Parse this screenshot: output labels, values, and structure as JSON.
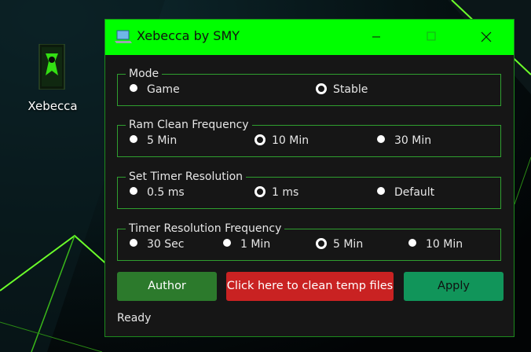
{
  "desktop": {
    "icon_label": "Xebecca",
    "accent_color": "#7cff3a"
  },
  "window": {
    "title": "Xebecca by SMY",
    "titlebar_color": "#00ff00"
  },
  "groups": [
    {
      "title": "Mode",
      "options": [
        {
          "label": "Game",
          "checked": false
        },
        {
          "label": "Stable",
          "checked": true
        }
      ]
    },
    {
      "title": "Ram Clean Frequency",
      "options": [
        {
          "label": "5 Min",
          "checked": false
        },
        {
          "label": "10 Min",
          "checked": true
        },
        {
          "label": "30 Min",
          "checked": false
        }
      ]
    },
    {
      "title": "Set Timer Resolution",
      "options": [
        {
          "label": "0.5 ms",
          "checked": false
        },
        {
          "label": "1 ms",
          "checked": true
        },
        {
          "label": "Default",
          "checked": false
        }
      ]
    },
    {
      "title": "Timer Resolution Frequency",
      "options": [
        {
          "label": "30 Sec",
          "checked": false
        },
        {
          "label": "1 Min",
          "checked": false
        },
        {
          "label": "5 Min",
          "checked": true
        },
        {
          "label": "10 Min",
          "checked": false
        }
      ]
    }
  ],
  "buttons": {
    "author": "Author",
    "clean": "Click here to clean temp files",
    "apply": "Apply"
  },
  "status": "Ready"
}
